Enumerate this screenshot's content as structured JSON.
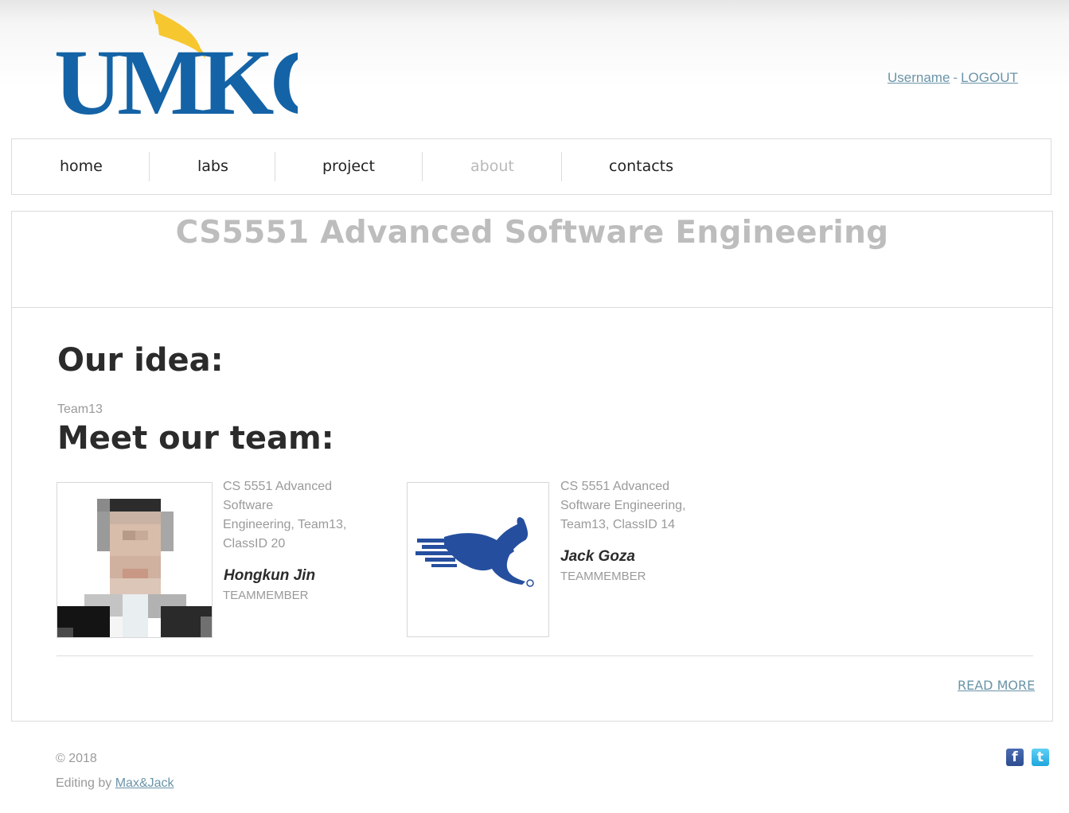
{
  "header": {
    "logo_text": "UMKC",
    "username_link": "Username",
    "separator": "-",
    "logout_link": "LOGOUT"
  },
  "nav": {
    "items": [
      {
        "label": "home",
        "active": false
      },
      {
        "label": "labs",
        "active": false
      },
      {
        "label": "project",
        "active": false
      },
      {
        "label": "about",
        "active": true
      },
      {
        "label": "contacts",
        "active": false
      }
    ]
  },
  "main": {
    "title": "CS5551 Advanced Software Engineering",
    "idea_heading": "Our idea:",
    "team_tag": "Team13",
    "team_heading": "Meet our team:",
    "members": [
      {
        "desc_lines": [
          "CS 5551 Advanced",
          "Software",
          "Engineering, Team13,",
          "ClassID 20"
        ],
        "name": "Hongkun Jin",
        "role": "TEAMMEMBER",
        "photo": "portrait-photo"
      },
      {
        "desc_lines": [
          "CS 5551 Advanced",
          "Software Engineering,",
          "Team13, ClassID 14"
        ],
        "name": "Jack Goza",
        "role": "TEAMMEMBER",
        "photo": "kangaroo-logo"
      }
    ],
    "read_more": "READ MORE"
  },
  "footer": {
    "copyright": "© 2018",
    "editing_prefix": "Editing by",
    "editing_link": "Max&Jack",
    "social": [
      "facebook-icon",
      "twitter-icon"
    ]
  },
  "colors": {
    "logo_blue": "#1463a6",
    "logo_gold": "#f6c72e",
    "link": "#6a94a8",
    "title_gray": "#bdbdbd",
    "heading_dark": "#2b2b2b",
    "kangaroo_blue": "#254f9e"
  }
}
